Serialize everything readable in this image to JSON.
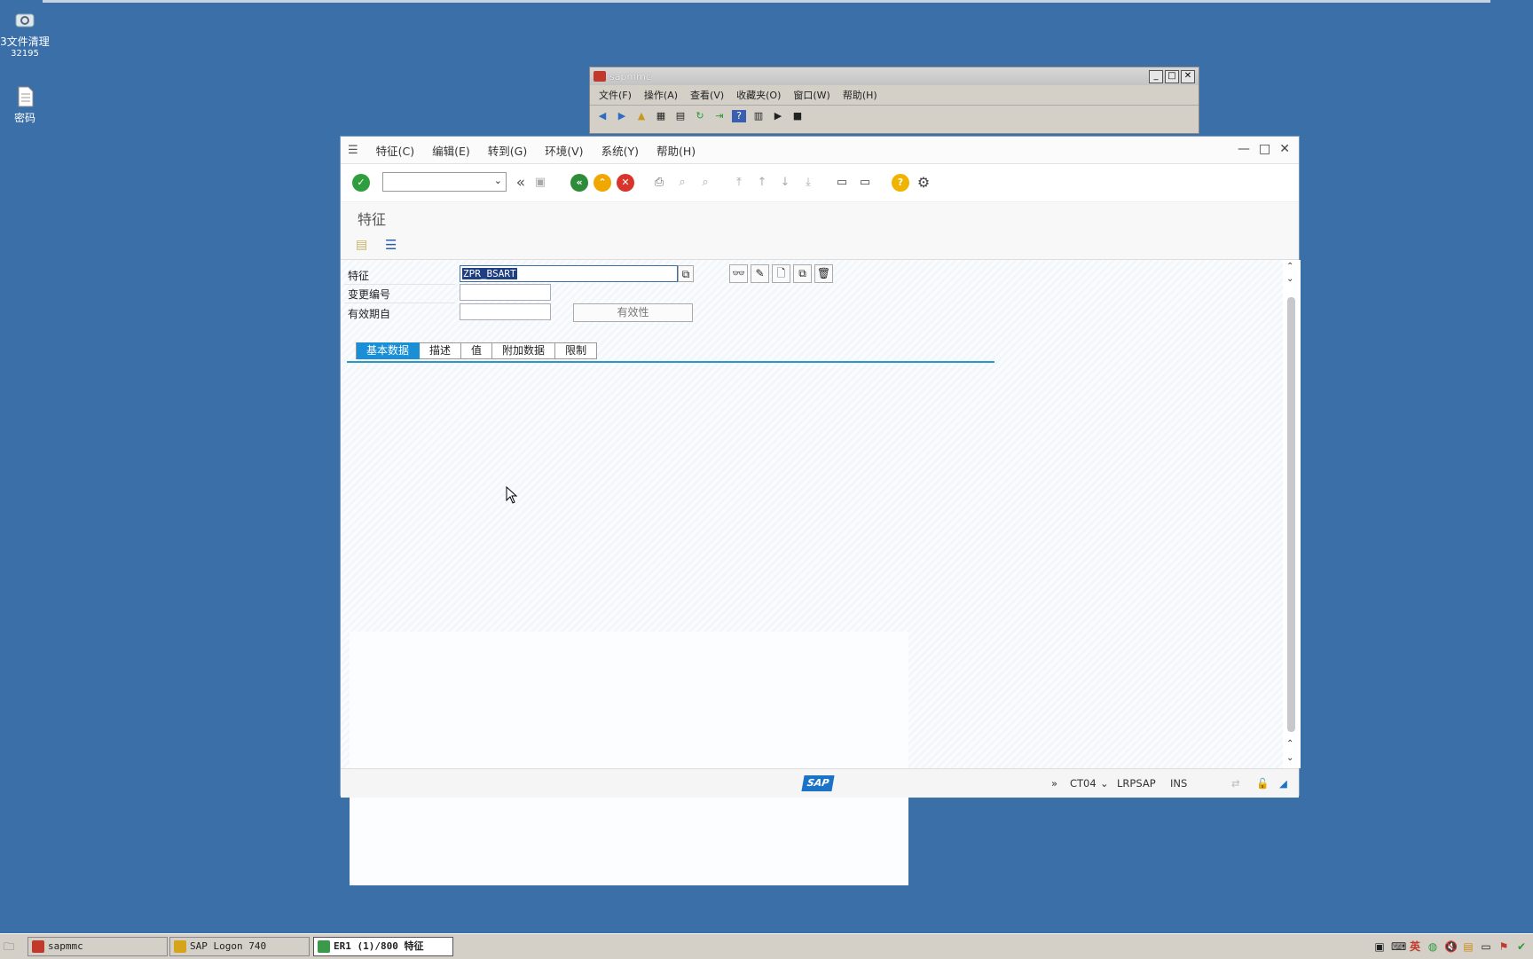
{
  "desktop": {
    "icons": [
      {
        "label": "3文件清理",
        "sub": "32195"
      },
      {
        "label": "密码",
        "sub": ""
      }
    ]
  },
  "mmc_window": {
    "title": "sapmmc",
    "menu": [
      "文件(F)",
      "操作(A)",
      "查看(V)",
      "收藏夹(O)",
      "窗口(W)",
      "帮助(H)"
    ]
  },
  "sap_window": {
    "menu": [
      "特征(C)",
      "编辑(E)",
      "转到(G)",
      "环境(V)",
      "系统(Y)",
      "帮助(H)"
    ],
    "page_title": "特征",
    "form": {
      "char_label": "特征",
      "char_value": "ZPR_BSART",
      "change_no_label": "变更编号",
      "change_no_value": "",
      "valid_from_label": "有效期自",
      "valid_from_value": "",
      "validity_button": "有效性"
    },
    "tabs": [
      "基本数据",
      "描述",
      "值",
      "附加数据",
      "限制"
    ],
    "active_tab": "基本数据",
    "status": {
      "expand": "»",
      "tcode": "CT04",
      "server": "LRPSAP",
      "mode": "INS"
    },
    "colors": {
      "accent": "#1a8fd6",
      "ok_green": "#2e9e3e",
      "back_green": "#2e8b3a",
      "exit_orange": "#f0a800",
      "cancel_red": "#d9342b",
      "help_yellow": "#f0b400"
    }
  },
  "taskbar": {
    "tasks": [
      "sapmmc",
      "SAP Logon 740",
      "ER1 (1)/800 特征"
    ],
    "active_task": "ER1 (1)/800 特征"
  }
}
